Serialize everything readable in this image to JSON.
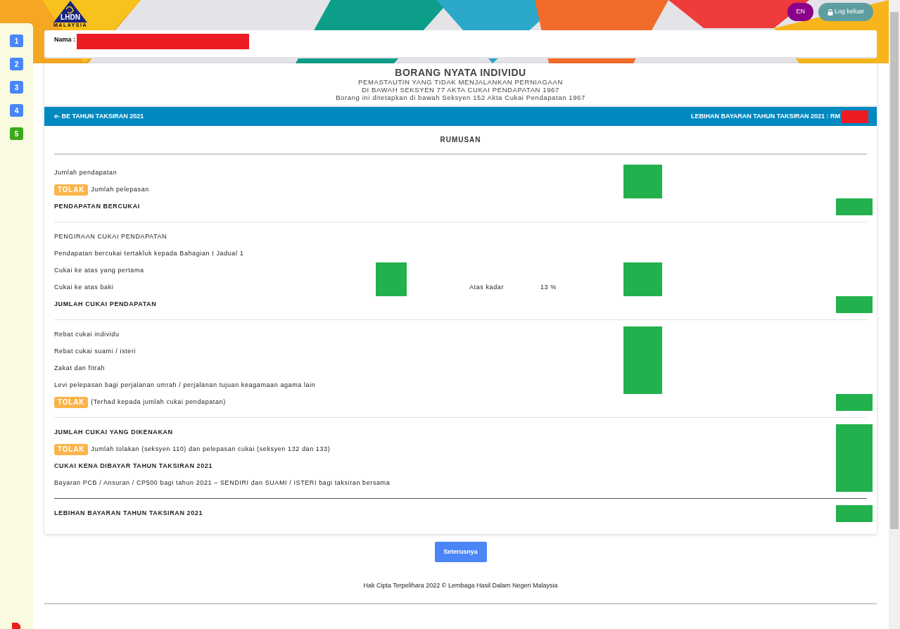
{
  "logo": {
    "name": "LHDN",
    "subtitle": "MALAYSIA"
  },
  "top_buttons": [
    {
      "kind": "language",
      "label": "EN"
    },
    {
      "kind": "logout",
      "label": "Log keluar"
    }
  ],
  "steps": [
    {
      "label": "1",
      "selected": false
    },
    {
      "label": "2",
      "selected": false
    },
    {
      "label": "3",
      "selected": false
    },
    {
      "label": "4",
      "selected": false
    },
    {
      "label": "5",
      "selected": true
    }
  ],
  "name_field": {
    "label": "Nama :"
  },
  "form_header": {
    "title": "BORANG NYATA INDIVIDU",
    "lines": [
      "PEMASTAUTIN YANG TIDAK MENJALANKAN PERNIAGAAN",
      "DI BAWAH SEKSYEN 77 AKTA CUKAI PENDAPATAN 1967",
      "Borang ini ditetapkan di bawah Seksyen 152 Akta Cukai Pendapatan 1967"
    ]
  },
  "info_bar": {
    "left": "e- BE TAHUN TAKSIRAN 2021",
    "right": "LEBIHAN BAYARAN TAHUN TAKSIRAN 2021 : RM"
  },
  "summary": {
    "title": "RUMUSAN",
    "sections": [
      {
        "rule_after": true,
        "rule_dark": false,
        "rows": [
          {
            "label": "Jumlah pendapatan",
            "bold": false,
            "redacted_a": false,
            "redacted_b": true,
            "redacted_c": false
          },
          {
            "badge": "TOLAK",
            "label": "Jumlah pelepasan",
            "bold": false,
            "redacted_a": false,
            "redacted_b": true,
            "redacted_c": false
          },
          {
            "label": "PENDAPATAN BERCUKAI",
            "bold": true,
            "redacted_a": false,
            "redacted_b": false,
            "redacted_c": true
          }
        ]
      },
      {
        "rule_after": true,
        "rule_dark": false,
        "rows": [
          {
            "label": "PENGIRAAN CUKAI PENDAPATAN",
            "bold": false,
            "redacted_a": false,
            "redacted_b": false,
            "redacted_c": false
          },
          {
            "label": "Pendapatan bercukai tertakluk kepada Bahagian I Jadual 1",
            "bold": false,
            "redacted_a": false,
            "redacted_b": false,
            "redacted_c": false
          },
          {
            "label": "Cukai ke atas yang pertama",
            "bold": false,
            "redacted_a": true,
            "redacted_b": true,
            "redacted_c": false
          },
          {
            "label": "Cukai ke atas baki",
            "bold": false,
            "redacted_a": true,
            "redacted_b": true,
            "redacted_c": false,
            "rate_label": "Atas kadar",
            "rate": "13 %"
          },
          {
            "label": "JUMLAH CUKAI PENDAPATAN",
            "bold": true,
            "redacted_a": false,
            "redacted_b": false,
            "redacted_c": true
          }
        ]
      },
      {
        "rule_after": true,
        "rule_dark": false,
        "rows": [
          {
            "label": "Rebat cukai individu",
            "bold": false,
            "redacted_a": false,
            "redacted_b": true,
            "redacted_c": false
          },
          {
            "label": "Rebat cukai suami / isteri",
            "bold": false,
            "redacted_a": false,
            "redacted_b": true,
            "redacted_c": false
          },
          {
            "label": "Zakat dan fitrah",
            "bold": false,
            "redacted_a": false,
            "redacted_b": true,
            "redacted_c": false
          },
          {
            "label": "Levi pelepasan bagi perjalanan umrah / perjalanan tujuan keagamaan agama lain",
            "bold": false,
            "redacted_a": false,
            "redacted_b": true,
            "redacted_c": false
          },
          {
            "badge": "TOLAK",
            "label": "(Terhad kepada jumlah cukai pendapatan)",
            "bold": false,
            "redacted_a": false,
            "redacted_b": false,
            "redacted_c": true
          }
        ]
      },
      {
        "rule_after": true,
        "rule_dark": true,
        "rows": [
          {
            "label": "JUMLAH CUKAI YANG DIKENAKAN",
            "bold": true,
            "redacted_a": false,
            "redacted_b": false,
            "redacted_c": true
          },
          {
            "badge": "TOLAK",
            "label": "Jumlah tolakan (seksyen 110) dan pelepasan cukai (seksyen 132 dan 133)",
            "bold": false,
            "redacted_a": false,
            "redacted_b": false,
            "redacted_c": true
          },
          {
            "label": "CUKAI KENA DIBAYAR TAHUN TAKSIRAN 2021",
            "bold": true,
            "redacted_a": false,
            "redacted_b": false,
            "redacted_c": true
          },
          {
            "label": "Bayaran PCB / Ansuran / CP500 bagi tahun 2021 – SENDIRI dan SUAMI / ISTERI bagi taksiran bersama",
            "bold": false,
            "redacted_a": false,
            "redacted_b": false,
            "redacted_c": true
          }
        ]
      },
      {
        "rule_after": false,
        "rows": [
          {
            "label": "LEBIHAN BAYARAN TAHUN TAKSIRAN 2021",
            "bold": true,
            "redacted_a": false,
            "redacted_b": false,
            "redacted_c": true
          }
        ]
      }
    ]
  },
  "next_button": "Seterusnya",
  "footer": "Hak Cipta Terpelihara 2022 © Lembaga Hasil Dalam Negeri Malaysia"
}
